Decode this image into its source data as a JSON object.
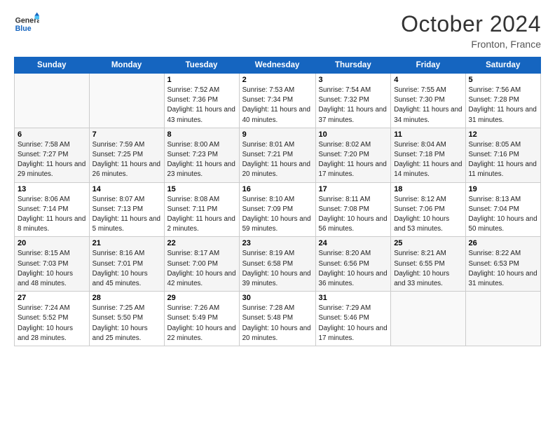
{
  "header": {
    "logo_line1": "General",
    "logo_line2": "Blue",
    "month": "October 2024",
    "location": "Fronton, France"
  },
  "weekdays": [
    "Sunday",
    "Monday",
    "Tuesday",
    "Wednesday",
    "Thursday",
    "Friday",
    "Saturday"
  ],
  "weeks": [
    [
      {
        "day": "",
        "info": ""
      },
      {
        "day": "",
        "info": ""
      },
      {
        "day": "1",
        "info": "Sunrise: 7:52 AM\nSunset: 7:36 PM\nDaylight: 11 hours and 43 minutes."
      },
      {
        "day": "2",
        "info": "Sunrise: 7:53 AM\nSunset: 7:34 PM\nDaylight: 11 hours and 40 minutes."
      },
      {
        "day": "3",
        "info": "Sunrise: 7:54 AM\nSunset: 7:32 PM\nDaylight: 11 hours and 37 minutes."
      },
      {
        "day": "4",
        "info": "Sunrise: 7:55 AM\nSunset: 7:30 PM\nDaylight: 11 hours and 34 minutes."
      },
      {
        "day": "5",
        "info": "Sunrise: 7:56 AM\nSunset: 7:28 PM\nDaylight: 11 hours and 31 minutes."
      }
    ],
    [
      {
        "day": "6",
        "info": "Sunrise: 7:58 AM\nSunset: 7:27 PM\nDaylight: 11 hours and 29 minutes."
      },
      {
        "day": "7",
        "info": "Sunrise: 7:59 AM\nSunset: 7:25 PM\nDaylight: 11 hours and 26 minutes."
      },
      {
        "day": "8",
        "info": "Sunrise: 8:00 AM\nSunset: 7:23 PM\nDaylight: 11 hours and 23 minutes."
      },
      {
        "day": "9",
        "info": "Sunrise: 8:01 AM\nSunset: 7:21 PM\nDaylight: 11 hours and 20 minutes."
      },
      {
        "day": "10",
        "info": "Sunrise: 8:02 AM\nSunset: 7:20 PM\nDaylight: 11 hours and 17 minutes."
      },
      {
        "day": "11",
        "info": "Sunrise: 8:04 AM\nSunset: 7:18 PM\nDaylight: 11 hours and 14 minutes."
      },
      {
        "day": "12",
        "info": "Sunrise: 8:05 AM\nSunset: 7:16 PM\nDaylight: 11 hours and 11 minutes."
      }
    ],
    [
      {
        "day": "13",
        "info": "Sunrise: 8:06 AM\nSunset: 7:14 PM\nDaylight: 11 hours and 8 minutes."
      },
      {
        "day": "14",
        "info": "Sunrise: 8:07 AM\nSunset: 7:13 PM\nDaylight: 11 hours and 5 minutes."
      },
      {
        "day": "15",
        "info": "Sunrise: 8:08 AM\nSunset: 7:11 PM\nDaylight: 11 hours and 2 minutes."
      },
      {
        "day": "16",
        "info": "Sunrise: 8:10 AM\nSunset: 7:09 PM\nDaylight: 10 hours and 59 minutes."
      },
      {
        "day": "17",
        "info": "Sunrise: 8:11 AM\nSunset: 7:08 PM\nDaylight: 10 hours and 56 minutes."
      },
      {
        "day": "18",
        "info": "Sunrise: 8:12 AM\nSunset: 7:06 PM\nDaylight: 10 hours and 53 minutes."
      },
      {
        "day": "19",
        "info": "Sunrise: 8:13 AM\nSunset: 7:04 PM\nDaylight: 10 hours and 50 minutes."
      }
    ],
    [
      {
        "day": "20",
        "info": "Sunrise: 8:15 AM\nSunset: 7:03 PM\nDaylight: 10 hours and 48 minutes."
      },
      {
        "day": "21",
        "info": "Sunrise: 8:16 AM\nSunset: 7:01 PM\nDaylight: 10 hours and 45 minutes."
      },
      {
        "day": "22",
        "info": "Sunrise: 8:17 AM\nSunset: 7:00 PM\nDaylight: 10 hours and 42 minutes."
      },
      {
        "day": "23",
        "info": "Sunrise: 8:19 AM\nSunset: 6:58 PM\nDaylight: 10 hours and 39 minutes."
      },
      {
        "day": "24",
        "info": "Sunrise: 8:20 AM\nSunset: 6:56 PM\nDaylight: 10 hours and 36 minutes."
      },
      {
        "day": "25",
        "info": "Sunrise: 8:21 AM\nSunset: 6:55 PM\nDaylight: 10 hours and 33 minutes."
      },
      {
        "day": "26",
        "info": "Sunrise: 8:22 AM\nSunset: 6:53 PM\nDaylight: 10 hours and 31 minutes."
      }
    ],
    [
      {
        "day": "27",
        "info": "Sunrise: 7:24 AM\nSunset: 5:52 PM\nDaylight: 10 hours and 28 minutes."
      },
      {
        "day": "28",
        "info": "Sunrise: 7:25 AM\nSunset: 5:50 PM\nDaylight: 10 hours and 25 minutes."
      },
      {
        "day": "29",
        "info": "Sunrise: 7:26 AM\nSunset: 5:49 PM\nDaylight: 10 hours and 22 minutes."
      },
      {
        "day": "30",
        "info": "Sunrise: 7:28 AM\nSunset: 5:48 PM\nDaylight: 10 hours and 20 minutes."
      },
      {
        "day": "31",
        "info": "Sunrise: 7:29 AM\nSunset: 5:46 PM\nDaylight: 10 hours and 17 minutes."
      },
      {
        "day": "",
        "info": ""
      },
      {
        "day": "",
        "info": ""
      }
    ]
  ]
}
